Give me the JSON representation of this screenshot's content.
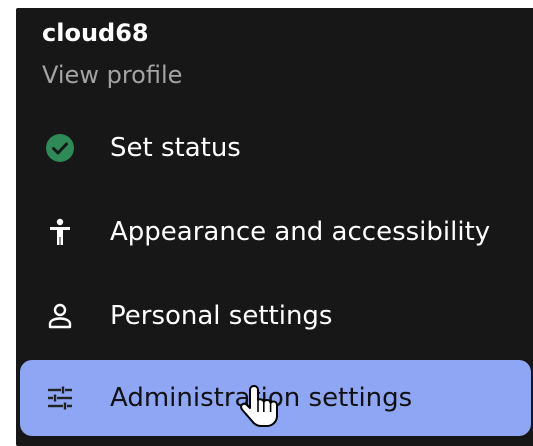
{
  "user": {
    "name": "cloud68",
    "view_profile": "View profile"
  },
  "menu": {
    "items": [
      {
        "label": "Set status",
        "icon": "check-circle-icon",
        "status_color": "#2e8b57"
      },
      {
        "label": "Appearance and accessibility",
        "icon": "accessibility-icon"
      },
      {
        "label": "Personal settings",
        "icon": "person-icon"
      },
      {
        "label": "Administration settings",
        "icon": "tune-icon",
        "active": true
      }
    ]
  },
  "colors": {
    "menu_bg": "#171717",
    "active_bg": "#8ea6f3",
    "muted_text": "#a3a3a3"
  }
}
